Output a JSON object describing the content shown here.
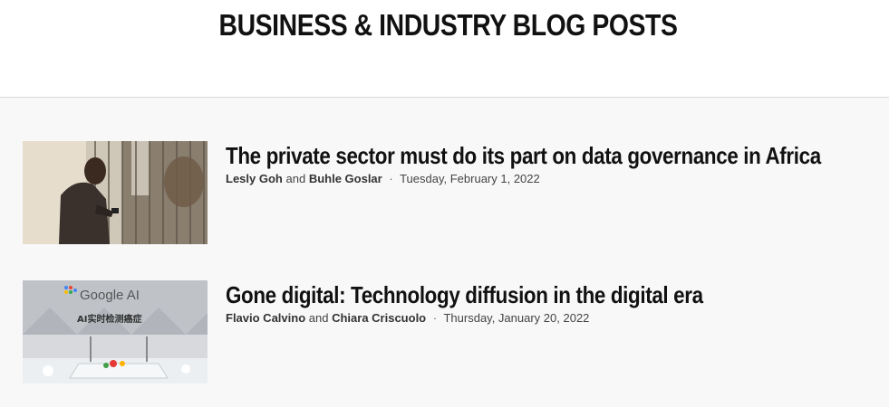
{
  "section": {
    "title": "BUSINESS & INDUSTRY BLOG POSTS"
  },
  "posts": [
    {
      "title": "The private sector must do its part on data governance in Africa",
      "author1": "Lesly Goh",
      "conjunction": "and",
      "author2": "Buhle Goslar",
      "separator": "·",
      "date": "Tuesday, February 1, 2022",
      "image_icon": "man-with-phone-photo"
    },
    {
      "title": "Gone digital: Technology diffusion in the digital era",
      "author1": "Flavio Calvino",
      "conjunction": "and",
      "author2": "Chiara Criscuolo",
      "separator": "·",
      "date": "Thursday, January 20, 2022",
      "image_icon": "google-ai-booth-photo",
      "image_text": {
        "brand": "Google AI",
        "caption": "AI实时检测癌症"
      }
    }
  ]
}
